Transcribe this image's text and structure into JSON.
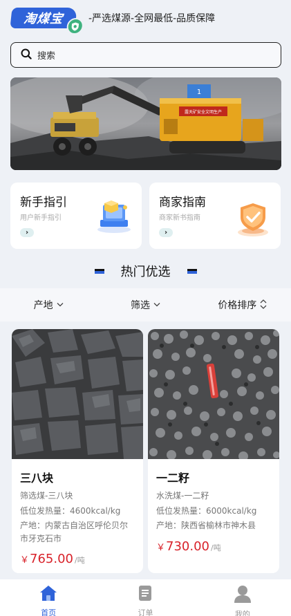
{
  "header": {
    "logo_text": "淘煤宝",
    "slogan": "-严选煤源-全网最低-品质保障"
  },
  "search": {
    "placeholder": "搜索",
    "icon": "search-icon"
  },
  "banner": {
    "sign_text": "露天矿安全文明生产",
    "badge_text": "1"
  },
  "cards": [
    {
      "title": "新手指引",
      "subtitle": "用户新手指引",
      "arrow": "›",
      "icon": "laptop-cube-icon"
    },
    {
      "title": "商家指南",
      "subtitle": "商家新书指南",
      "arrow": "›",
      "icon": "shield-check-icon"
    }
  ],
  "section": {
    "title": "热门优选"
  },
  "filters": [
    {
      "label": "产地",
      "icon": "chevron-down-icon"
    },
    {
      "label": "筛选",
      "icon": "chevron-down-icon"
    },
    {
      "label": "价格排序",
      "icon": "sort-updown-icon"
    }
  ],
  "products": [
    {
      "name": "三八块",
      "category": "筛选煤-三八块",
      "heat": "低位发热量：4600kcal/kg",
      "origin": "产地：内蒙古自治区呼伦贝尔市牙克石市",
      "price_symbol": "￥",
      "price": "765.00",
      "unit": "/吨"
    },
    {
      "name": "一二籽",
      "category": "水洗煤-一二籽",
      "heat": "低位发热量：6000kcal/kg",
      "origin": "产地：陕西省榆林市神木县",
      "price_symbol": "￥",
      "price": "730.00",
      "unit": "/吨"
    }
  ],
  "tabbar": {
    "items": [
      {
        "label": "首页",
        "icon": "home-icon",
        "active": true
      },
      {
        "label": "订单",
        "icon": "order-list-icon",
        "active": false
      },
      {
        "label": "我的",
        "icon": "user-icon",
        "active": false
      }
    ]
  },
  "colors": {
    "accent": "#2f63d9",
    "price": "#d8222a",
    "background": "#eef1f6",
    "tab_active": "#2f63d9",
    "tab_inactive": "#999999"
  }
}
